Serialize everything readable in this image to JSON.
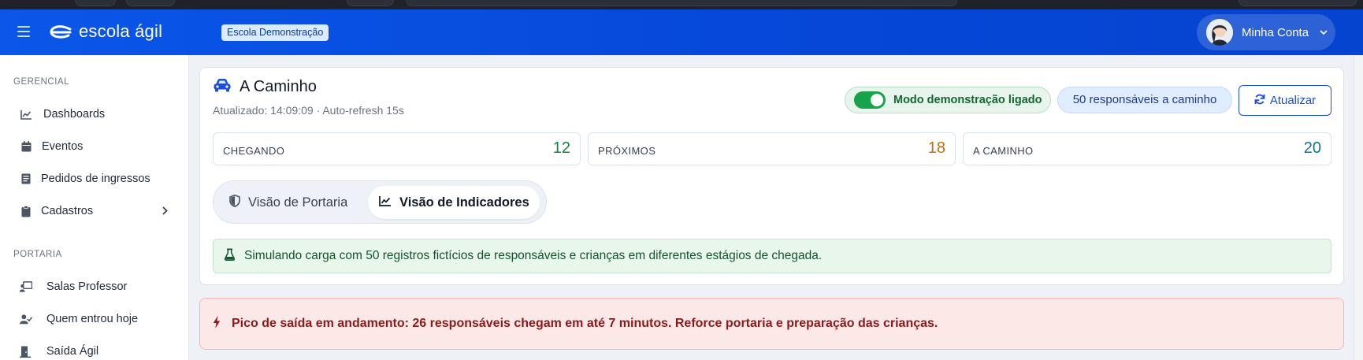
{
  "header": {
    "logo_text": "escola ágil",
    "school_badge": "Escola Demonstração",
    "account_label": "Minha Conta"
  },
  "sidebar": {
    "sections": [
      {
        "title": "GERENCIAL",
        "items": [
          {
            "label": "Dashboards",
            "icon": "chart-line-icon"
          },
          {
            "label": "Eventos",
            "icon": "calendar-icon"
          },
          {
            "label": "Pedidos de ingressos",
            "icon": "receipt-icon"
          },
          {
            "label": "Cadastros",
            "icon": "clipboard-icon",
            "has_submenu": true
          }
        ]
      },
      {
        "title": "PORTARIA",
        "items": [
          {
            "label": "Salas Professor",
            "icon": "chalkboard-user-icon"
          },
          {
            "label": "Quem entrou hoje",
            "icon": "user-check-icon"
          },
          {
            "label": "Saída Ágil",
            "icon": "door-exit-icon"
          }
        ]
      }
    ]
  },
  "panel": {
    "title": "A Caminho",
    "updated": "Atualizado: 14:09:09 · Auto-refresh 15s",
    "demo_mode_label": "Modo demonstração ligado",
    "demo_mode_on": true,
    "en_route_count_label": "50 responsáveis a caminho",
    "refresh_label": "Atualizar",
    "stats": [
      {
        "label": "CHEGANDO",
        "value": "12",
        "color": "#15803d"
      },
      {
        "label": "PRÓXIMOS",
        "value": "18",
        "color": "#c2700c"
      },
      {
        "label": "A CAMINHO",
        "value": "20",
        "color": "#0e7490"
      }
    ],
    "views": [
      {
        "label": "Visão de Portaria",
        "icon": "shield-icon",
        "active": false
      },
      {
        "label": "Visão de Indicadores",
        "icon": "chart-line-icon",
        "active": true
      }
    ],
    "simulation_notice": "Simulando carga com 50 registros fictícios de responsáveis e crianças em diferentes estágios de chegada."
  },
  "alert": {
    "text": "Pico de saída em andamento: 26 responsáveis chegam em até 7 minutos. Reforce portaria e preparação das crianças."
  },
  "colors": {
    "brand_blue": "#0a57e8",
    "success_green": "#16a34a",
    "danger_red": "#8b1a1a"
  }
}
